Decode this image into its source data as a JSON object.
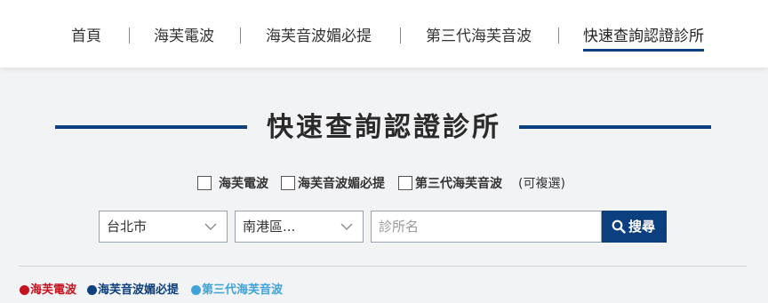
{
  "nav": {
    "items": [
      {
        "label": "首頁"
      },
      {
        "label": "海芙電波"
      },
      {
        "label": "海芙音波媚必提"
      },
      {
        "label": "第三代海芙音波"
      },
      {
        "label": "快速查詢認證診所"
      }
    ],
    "active_index": 4
  },
  "heading": {
    "title": "快速查詢認證診所"
  },
  "filters": {
    "options": [
      {
        "label": "海芙電波",
        "checked": false
      },
      {
        "label": "海芙音波媚必提",
        "checked": false
      },
      {
        "label": "第三代海芙音波",
        "checked": false
      }
    ],
    "note": "(可複選)"
  },
  "search": {
    "city_select": "台北市",
    "district_select": "南港區...",
    "clinic_placeholder": "診所名",
    "button_label": "搜尋",
    "button_icon": "search-icon"
  },
  "legend": {
    "items": [
      {
        "label": "海芙電波",
        "color": "#c4121f"
      },
      {
        "label": "海芙音波媚必提",
        "color": "#0c3f7d"
      },
      {
        "label": "第三代海芙音波",
        "color": "#3fa3d9"
      }
    ]
  },
  "colors": {
    "accent": "#0c3f7d",
    "page_bg": "#f2f3f5"
  }
}
